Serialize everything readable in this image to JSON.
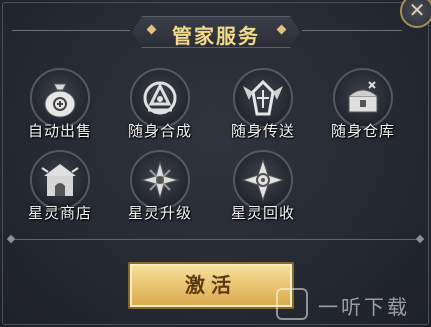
{
  "panel": {
    "title": "管家服务",
    "close_icon": "close-x-icon",
    "accent_color": "#f3d98a"
  },
  "services": [
    {
      "label": "自动出售",
      "icon": "money-bag-icon"
    },
    {
      "label": "随身合成",
      "icon": "anvil-emblem-icon"
    },
    {
      "label": "随身传送",
      "icon": "winged-portal-icon"
    },
    {
      "label": "随身仓库",
      "icon": "treasure-chest-icon"
    },
    {
      "label": "星灵商店",
      "icon": "shop-building-icon"
    },
    {
      "label": "星灵升级",
      "icon": "upgrade-star-icon"
    },
    {
      "label": "星灵回收",
      "icon": "recycle-star-icon"
    }
  ],
  "activate_button": {
    "label": "激活"
  },
  "watermark": {
    "text": "一听下载"
  }
}
